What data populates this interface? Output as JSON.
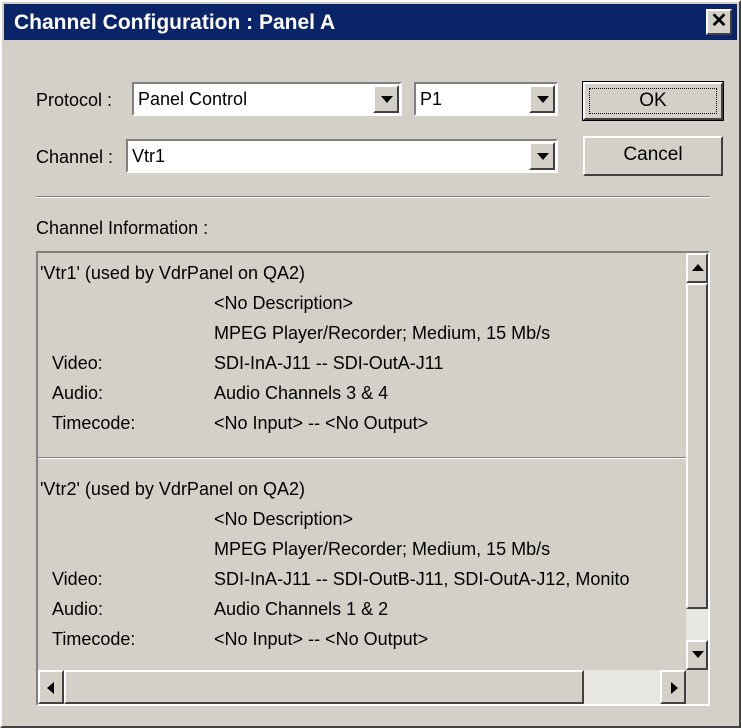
{
  "window": {
    "title": "Channel Configuration : Panel A",
    "close_glyph": "✕"
  },
  "protocol": {
    "label": "Protocol :",
    "value": "Panel Control",
    "sub_value": "P1"
  },
  "channel": {
    "label": "Channel :",
    "value": "Vtr1"
  },
  "buttons": {
    "ok": "OK",
    "cancel": "Cancel"
  },
  "info": {
    "label": "Channel Information :",
    "entries": [
      {
        "header": "'Vtr1' (used by VdrPanel on QA2)",
        "description": "<No Description>",
        "device": "MPEG Player/Recorder; Medium, 15 Mb/s",
        "video_label": "Video:",
        "video": "SDI-InA-J11 -- SDI-OutA-J11",
        "audio_label": "Audio:",
        "audio": "Audio Channels 3 & 4",
        "timecode_label": "Timecode:",
        "timecode": "<No Input> -- <No Output>"
      },
      {
        "header": "'Vtr2' (used by VdrPanel on QA2)",
        "description": "<No Description>",
        "device": "MPEG Player/Recorder; Medium, 15 Mb/s",
        "video_label": "Video:",
        "video": "SDI-InA-J11 -- SDI-OutB-J11, SDI-OutA-J12, Monito",
        "audio_label": "Audio:",
        "audio": "Audio Channels 1 & 2",
        "timecode_label": "Timecode:",
        "timecode": "<No Input> -- <No Output>"
      }
    ]
  },
  "colors": {
    "titlebar": "#0a246a",
    "face": "#d4d0c8"
  }
}
